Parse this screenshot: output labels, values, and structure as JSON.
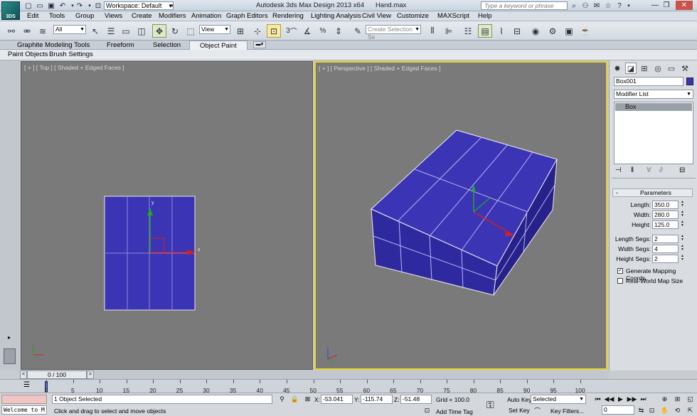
{
  "titlebar": {
    "app_title": "Autodesk 3ds Max Design 2013 x64",
    "file_name": "Hand.max",
    "workspace": "Workspace: Default",
    "search_placeholder": "Type a keyword or phrase",
    "logo_text": "3DS"
  },
  "menu": [
    "Edit",
    "Tools",
    "Group",
    "Views",
    "Create",
    "Modifiers",
    "Animation",
    "Graph Editors",
    "Rendering",
    "Lighting Analysis",
    "Civil View",
    "Customize",
    "MAXScript",
    "Help"
  ],
  "toolbar": {
    "filter": "All",
    "ref_coord": "View",
    "named_selection_placeholder": "Create Selection Se",
    "snap_num": "3",
    "percent": "%"
  },
  "ribbon": {
    "tabs": [
      "Graphite Modeling Tools",
      "Freeform",
      "Selection",
      "Object Paint"
    ],
    "active_tab": "Object Paint",
    "subtabs": [
      "Paint Objects",
      "Brush Settings"
    ]
  },
  "viewports": {
    "left_label": "[ + ] [ Top ] [ Shaded + Edged Faces ]",
    "right_label": "[ + ] [ Perspective ] [ Shaded + Edged Faces ]",
    "gizmo_x": "x",
    "gizmo_y": "y",
    "active": "right",
    "object_color": "#3b34b5"
  },
  "command_panel": {
    "object_name": "Box001",
    "object_swatch": "#3b34b5",
    "modifier_list": "Modifier List",
    "stack_item": "Box",
    "rollout_title": "Parameters",
    "params": [
      {
        "label": "Length:",
        "value": "350.0"
      },
      {
        "label": "Width:",
        "value": "280.0"
      },
      {
        "label": "Height:",
        "value": "125.0"
      }
    ],
    "segs": [
      {
        "label": "Length Segs:",
        "value": "2"
      },
      {
        "label": "Width Segs:",
        "value": "4"
      },
      {
        "label": "Height Segs:",
        "value": "2"
      }
    ],
    "gen_mapping": "Generate Mapping Coords.",
    "gen_mapping_checked": true,
    "real_world": "Real-World Map Size",
    "real_world_checked": false
  },
  "timeline": {
    "slider_text": "0 / 100",
    "ticks": [
      "0",
      "5",
      "10",
      "15",
      "20",
      "25",
      "30",
      "35",
      "40",
      "45",
      "50",
      "55",
      "60",
      "65",
      "70",
      "75",
      "80",
      "85",
      "90",
      "95",
      "100"
    ]
  },
  "status": {
    "maxscript_listener": "Welcome to M",
    "selected": "1 Object Selected",
    "prompt": "Click and drag to select and move objects",
    "x_label": "X:",
    "x_value": "-53.041",
    "y_label": "Y:",
    "y_value": "-115.74",
    "z_label": "Z:",
    "z_value": "-51.48",
    "grid": "Grid = 100.0",
    "add_time_tag": "Add Time Tag",
    "auto_key": "Auto Key",
    "set_key": "Set Key",
    "selected_dropdown": "Selected",
    "key_filters": "Key Filters...",
    "frame": "0"
  }
}
